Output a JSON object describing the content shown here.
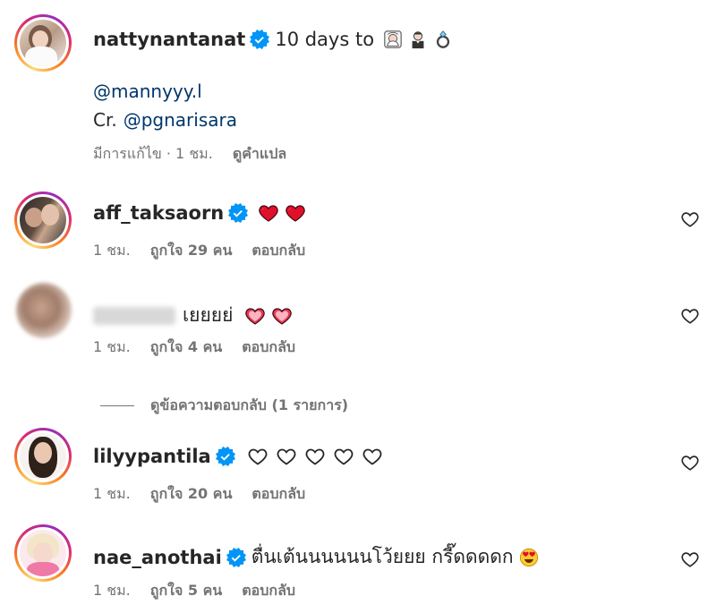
{
  "post": {
    "username": "nattynantanat",
    "caption": "10 days to",
    "caption_emoji": [
      "bride-icon",
      "groom-icon",
      "ring-icon"
    ],
    "mention_line": "@mannyyy.l",
    "credit_prefix": "Cr.",
    "credit_handle": "@pgnarisara",
    "meta_time": "มีการแก้ไข · 1 ชม.",
    "translate_label": "ดูคำแปล"
  },
  "comments": [
    {
      "username": "aff_taksaorn",
      "text": "",
      "time": "1 ชม.",
      "likes": "ถูกใจ 29 คน",
      "reply": "ตอบกลับ"
    },
    {
      "username": "",
      "text": "เยยยย่",
      "time": "1 ชม.",
      "likes": "ถูกใจ 4 คน",
      "reply": "ตอบกลับ"
    },
    {
      "username": "lilyypantila",
      "text": "",
      "time": "1 ชม.",
      "likes": "ถูกใจ 20 คน",
      "reply": "ตอบกลับ"
    },
    {
      "username": "nae_anothai",
      "text": "ตื่นเต้นนนนนนโว้ยยย กรี๊ดดดดก",
      "time": "1 ชม.",
      "likes": "ถูกใจ 5 คน",
      "reply": "ตอบกลับ"
    }
  ],
  "view_replies_label": "ดูข้อความตอบกลับ (1 รายการ)",
  "colors": {
    "verified": "#0095f6",
    "meta": "#737373",
    "link": "#00376b",
    "heart": "#e0102b"
  }
}
